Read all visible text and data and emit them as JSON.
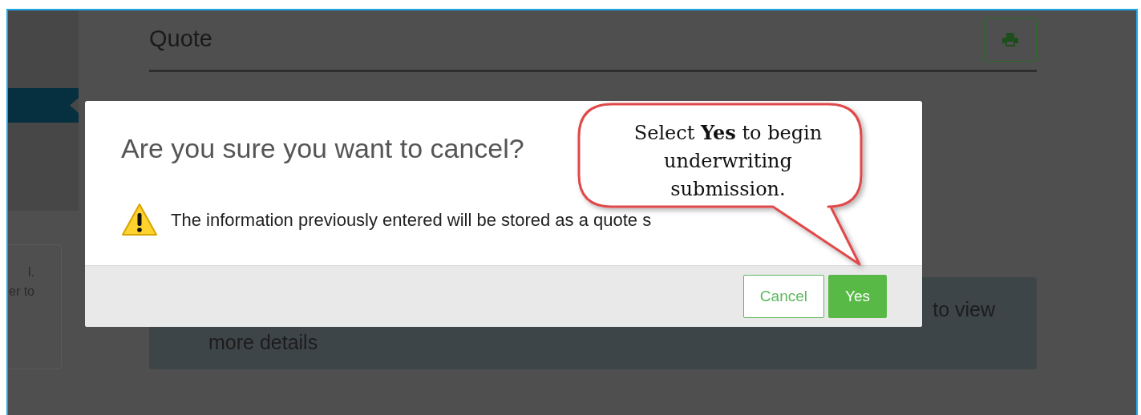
{
  "sidebar": {
    "card_lines": [
      "l.",
      "er to"
    ]
  },
  "page": {
    "title": "Quote",
    "info_lines": [
      "to view",
      "more details"
    ]
  },
  "dialog": {
    "title": "Are you sure you want to cancel?",
    "message": "The information previously entered will be stored as a quote s",
    "buttons": [
      {
        "label": "Cancel",
        "kind": "secondary"
      },
      {
        "label": "Yes",
        "kind": "primary"
      }
    ]
  },
  "callout": {
    "text": "Select **Yes** to begin underwriting submission."
  }
}
